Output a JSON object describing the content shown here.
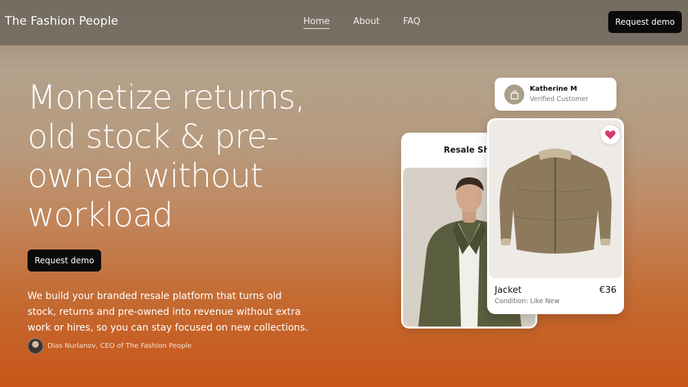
{
  "nav": {
    "brand": "The Fashion People",
    "links": [
      "Home",
      "About",
      "FAQ"
    ],
    "active_link": "Home",
    "cta_label": "Request demo"
  },
  "hero": {
    "headline": "Monetize returns, old stock & pre-owned without workload",
    "cta_label": "Request demo",
    "description": "We build your branded resale platform that turns old stock, returns and pre-owned into revenue without extra work or hires, so you can stay focused on new collections.",
    "author": "Dias Nurlanov, CEO of The Fashion People"
  },
  "showcase": {
    "back_card_title": "Resale Shop",
    "customer": {
      "name": "Katherine M",
      "status": "Verified Customer",
      "icon": "shopping-bag-icon"
    },
    "product": {
      "name": "Jacket",
      "price": "€36",
      "condition": "Condition: Like New",
      "favorite_icon": "heart-icon"
    }
  },
  "colors": {
    "cta_bg": "#0b0b0b",
    "heart": "#d6396a",
    "customer_badge": "#a89f88"
  }
}
